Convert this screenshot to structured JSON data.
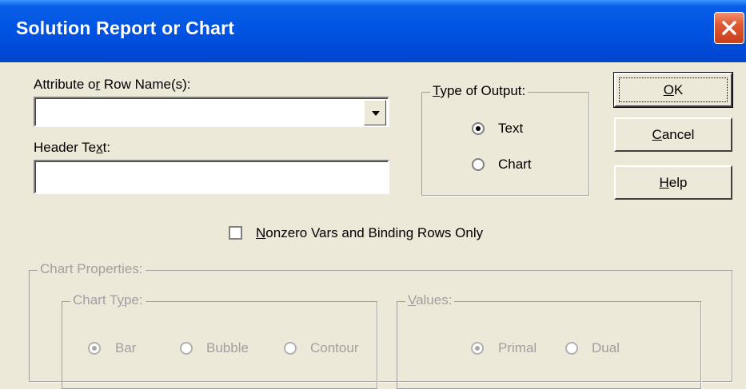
{
  "window": {
    "title": "Solution Report or Chart"
  },
  "attribute": {
    "label_pre": "Attribute o",
    "label_key": "r",
    "label_post": " Row Name(s):",
    "value": ""
  },
  "header_text": {
    "label_pre": "Header Te",
    "label_key": "x",
    "label_post": "t:",
    "value": ""
  },
  "output_type": {
    "legend_key": "T",
    "legend_rest": "ype of Output:",
    "options": [
      {
        "label": "Text",
        "selected": true
      },
      {
        "label": "Chart",
        "selected": false
      }
    ]
  },
  "buttons": {
    "ok_key": "O",
    "ok_rest": "K",
    "cancel_key": "C",
    "cancel_rest": "ancel",
    "help_key": "H",
    "help_rest": "elp"
  },
  "nonzero": {
    "key": "N",
    "rest": "onzero Vars and Binding Rows Only",
    "checked": false
  },
  "chart_properties": {
    "legend": "Chart Properties:",
    "chart_type": {
      "legend_pre": "Chart T",
      "legend_key": "y",
      "legend_post": "pe:",
      "options": [
        {
          "label": "Bar",
          "selected": true
        },
        {
          "label": "Bubble",
          "selected": false
        },
        {
          "label": "Contour",
          "selected": false
        }
      ]
    },
    "values": {
      "legend_key": "V",
      "legend_rest": "alues:",
      "options": [
        {
          "label": "Primal",
          "selected": true
        },
        {
          "label": "Dual",
          "selected": false
        }
      ]
    }
  }
}
